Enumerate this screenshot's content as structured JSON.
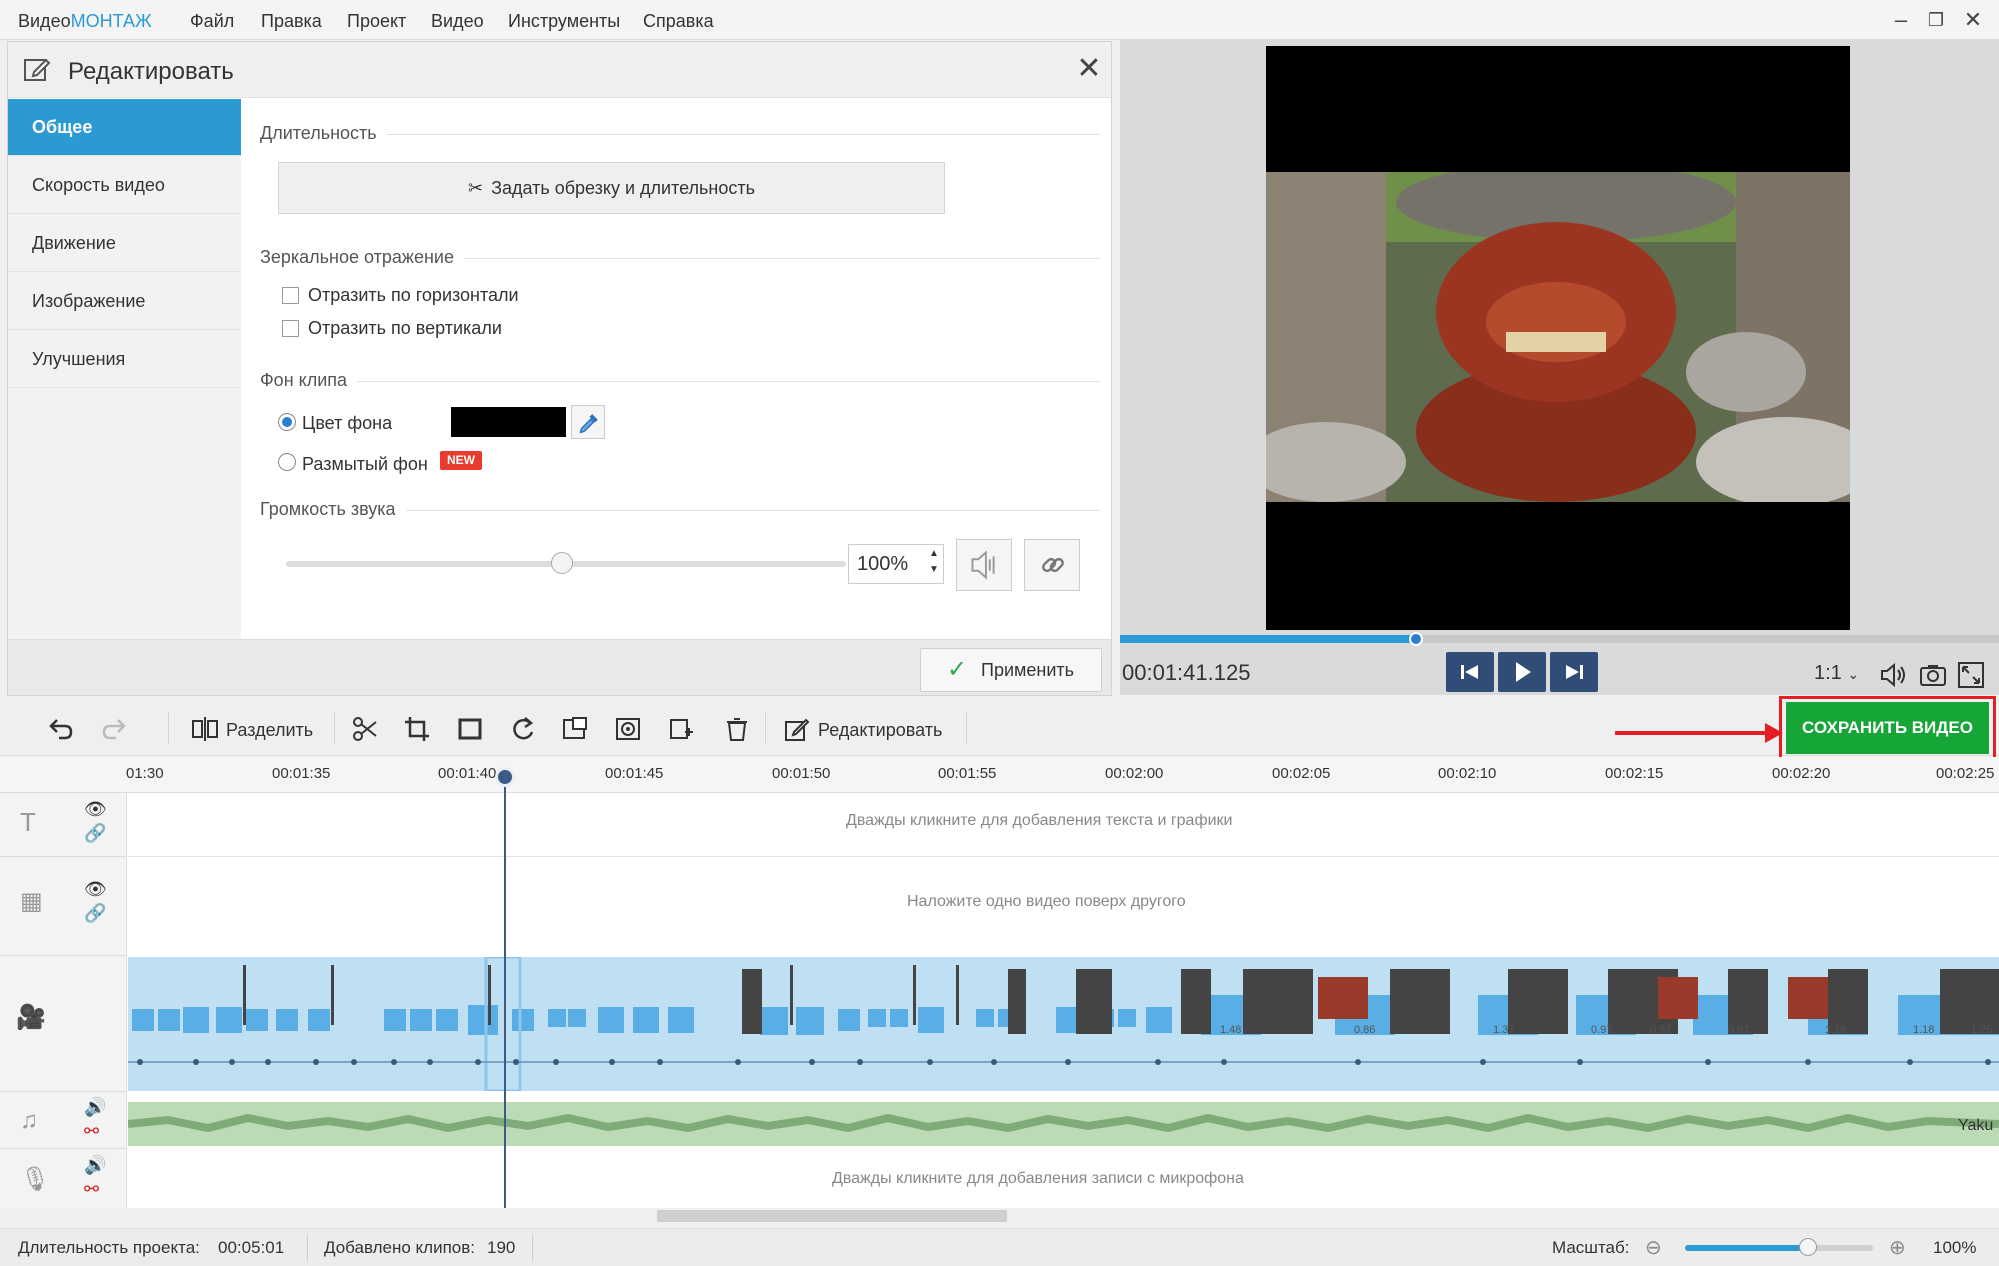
{
  "app": {
    "title_part1": "Видео",
    "title_part2": "МОНТАЖ"
  },
  "menu": [
    "Файл",
    "Правка",
    "Проект",
    "Видео",
    "Инструменты",
    "Справка"
  ],
  "edit_panel": {
    "title": "Редактировать",
    "nav": [
      "Общее",
      "Скорость видео",
      "Движение",
      "Изображение",
      "Улучшения"
    ],
    "active_nav": "Общее",
    "sections": {
      "duration": "Длительность",
      "mirror": "Зеркальное отражение",
      "background": "Фон клипа",
      "volume": "Громкость звука"
    },
    "trim_button": "Задать обрезку и длительность",
    "mirror_h": "Отразить по горизонтали",
    "mirror_v": "Отразить по вертикали",
    "bg_color": "Цвет фона",
    "bg_blur": "Размытый фон",
    "new_badge": "NEW",
    "volume_value": "100%",
    "volume_level": 0.5,
    "apply_button": "Применить"
  },
  "preview": {
    "timecode": "00:01:41.125",
    "progress": 0.337,
    "ratio": "1:1"
  },
  "toolbar": {
    "split_label": "Разделить",
    "edit_label": "Редактировать",
    "save_video": "СОХРАНИТЬ ВИДЕО"
  },
  "timeline": {
    "ticks": [
      "01:30",
      "00:01:35",
      "00:01:40",
      "00:01:45",
      "00:01:50",
      "00:01:55",
      "00:02:00",
      "00:02:05",
      "00:02:10",
      "00:02:15",
      "00:02:20",
      "00:02:25"
    ],
    "hint_text": "Дважды кликните для добавления текста и графики",
    "hint_overlay": "Наложите одно видео поверх другого",
    "hint_mic": "Дважды кликните для добавления записи с микрофона",
    "audio_label": "Yaku",
    "clip_durations": [
      "1.48",
      "0.86",
      "1.37",
      "0.97",
      "0.97",
      "0.97",
      "1.18",
      "1.18",
      "1.25"
    ]
  },
  "status": {
    "duration_label": "Длительность проекта:",
    "duration_value": "00:05:01",
    "clips_label": "Добавлено клипов:",
    "clips_value": "190",
    "zoom_label": "Масштаб:",
    "zoom_value": "100%"
  }
}
